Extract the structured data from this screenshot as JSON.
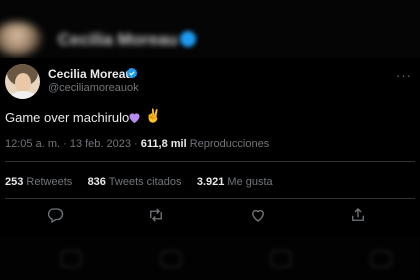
{
  "background_header": {
    "name": "Cecilia Moreau"
  },
  "tweet": {
    "author_name": "Cecilia Moreau",
    "handle": "@ceciliamoreauok",
    "text": "Game over machirulo",
    "emojis": [
      "purple-heart",
      "victory-hand"
    ],
    "victory_emoji": "✌",
    "time": "12:05 a. m.",
    "separator": " · ",
    "date": "13 feb. 2023",
    "views": "611,8 mil",
    "views_label": "Reproducciones",
    "retweets": "253",
    "retweets_label": "Retweets",
    "quotes": "836",
    "quotes_label": "Tweets citados",
    "likes": "3.921",
    "likes_label": "Me gusta",
    "more_icon": "···"
  },
  "colors": {
    "background": "#000000",
    "text": "#e7e9ea",
    "muted": "#71767b",
    "divider": "#2f3336",
    "verified": "#1d9bf0",
    "heart_emoji": "#b98cf2"
  }
}
